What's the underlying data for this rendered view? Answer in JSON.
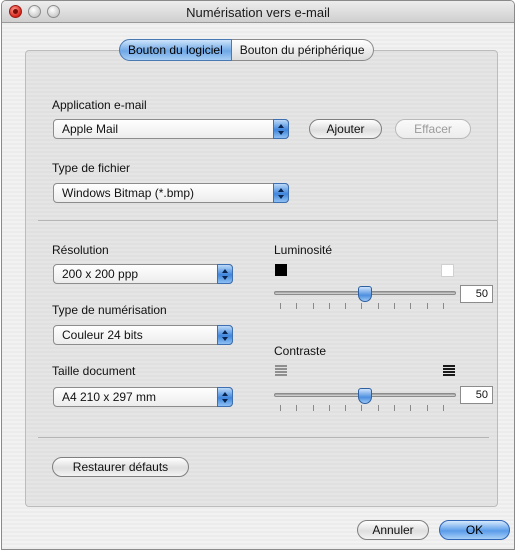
{
  "window": {
    "title": "Numérisation vers e-mail"
  },
  "tabs": [
    {
      "label": "Bouton du logiciel",
      "active": true
    },
    {
      "label": "Bouton du périphérique",
      "active": false
    }
  ],
  "email_app": {
    "label": "Application e-mail",
    "selected": "Apple Mail",
    "add_button": "Ajouter",
    "delete_button": "Effacer"
  },
  "file_type": {
    "label": "Type de fichier",
    "selected": "Windows Bitmap (*.bmp)"
  },
  "resolution": {
    "label": "Résolution",
    "selected": "200 x 200 ppp"
  },
  "scan_type": {
    "label": "Type de numérisation",
    "selected": "Couleur 24 bits"
  },
  "doc_size": {
    "label": "Taille document",
    "selected": "A4 210 x 297 mm"
  },
  "brightness": {
    "label": "Luminosité",
    "value": "50",
    "range": [
      0,
      100
    ]
  },
  "contrast": {
    "label": "Contraste",
    "value": "50",
    "range": [
      0,
      100
    ]
  },
  "restore_button": "Restaurer défauts",
  "footer": {
    "cancel_button": "Annuler",
    "ok_button": "OK"
  },
  "colors": {
    "accent": "#4a8fe0"
  }
}
